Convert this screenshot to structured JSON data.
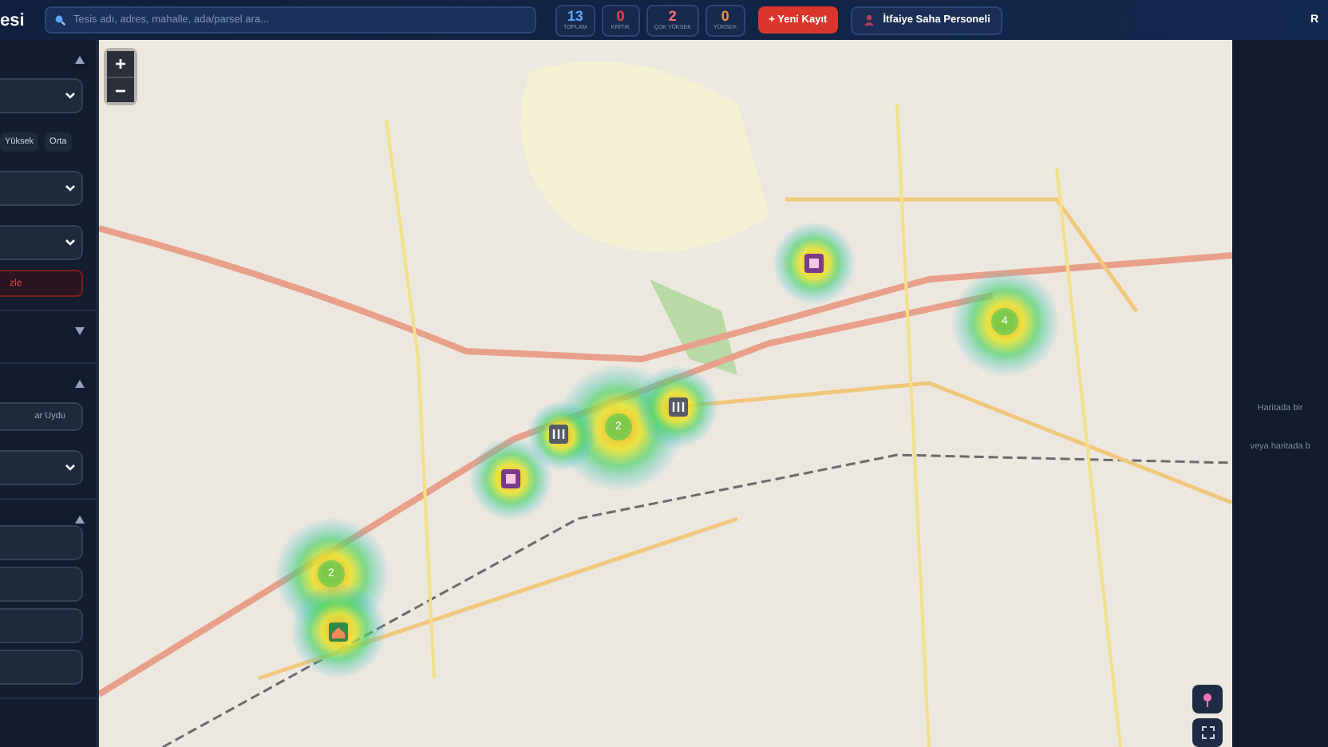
{
  "header": {
    "title": "esi",
    "search": {
      "placeholder": "Tesis adı, adres, mahalle, ada/parsel ara..."
    },
    "stats": [
      {
        "value": "13",
        "label": "TOPLAM",
        "color": "#60a5fa"
      },
      {
        "value": "0",
        "label": "KRİTİK",
        "color": "#ef4444"
      },
      {
        "value": "2",
        "label": "ÇOK YÜKSEK",
        "color": "#f87171"
      },
      {
        "value": "0",
        "label": "YÜKSEK",
        "color": "#fb923c"
      }
    ],
    "new_button": "+ Yeni Kayıt",
    "staff_button": "İtfaiye Saha Personeli",
    "user": "R"
  },
  "sidebar": {
    "sections": [
      {
        "expanded": true,
        "controls": [
          {
            "kind": "select"
          },
          {
            "kind": "chips",
            "chips": [
              "Yüksek",
              "Orta"
            ]
          },
          {
            "kind": "select"
          },
          {
            "kind": "select"
          },
          {
            "kind": "danger",
            "label": "zle"
          }
        ]
      },
      {
        "expanded": false
      },
      {
        "expanded": true,
        "controls": [
          {
            "kind": "button",
            "label": "ar Uydu"
          },
          {
            "kind": "select"
          }
        ]
      },
      {
        "expanded": true,
        "controls": [
          {
            "kind": "input"
          },
          {
            "kind": "input"
          },
          {
            "kind": "input"
          },
          {
            "kind": "input"
          }
        ]
      }
    ]
  },
  "map": {
    "zoom_in": "+",
    "zoom_out": "−",
    "clusters": [
      {
        "count": "4"
      },
      {
        "count": "2"
      },
      {
        "count": "2"
      }
    ]
  },
  "details": {
    "hint": "Haritada bir",
    "hint_2": "veya haritada b"
  }
}
